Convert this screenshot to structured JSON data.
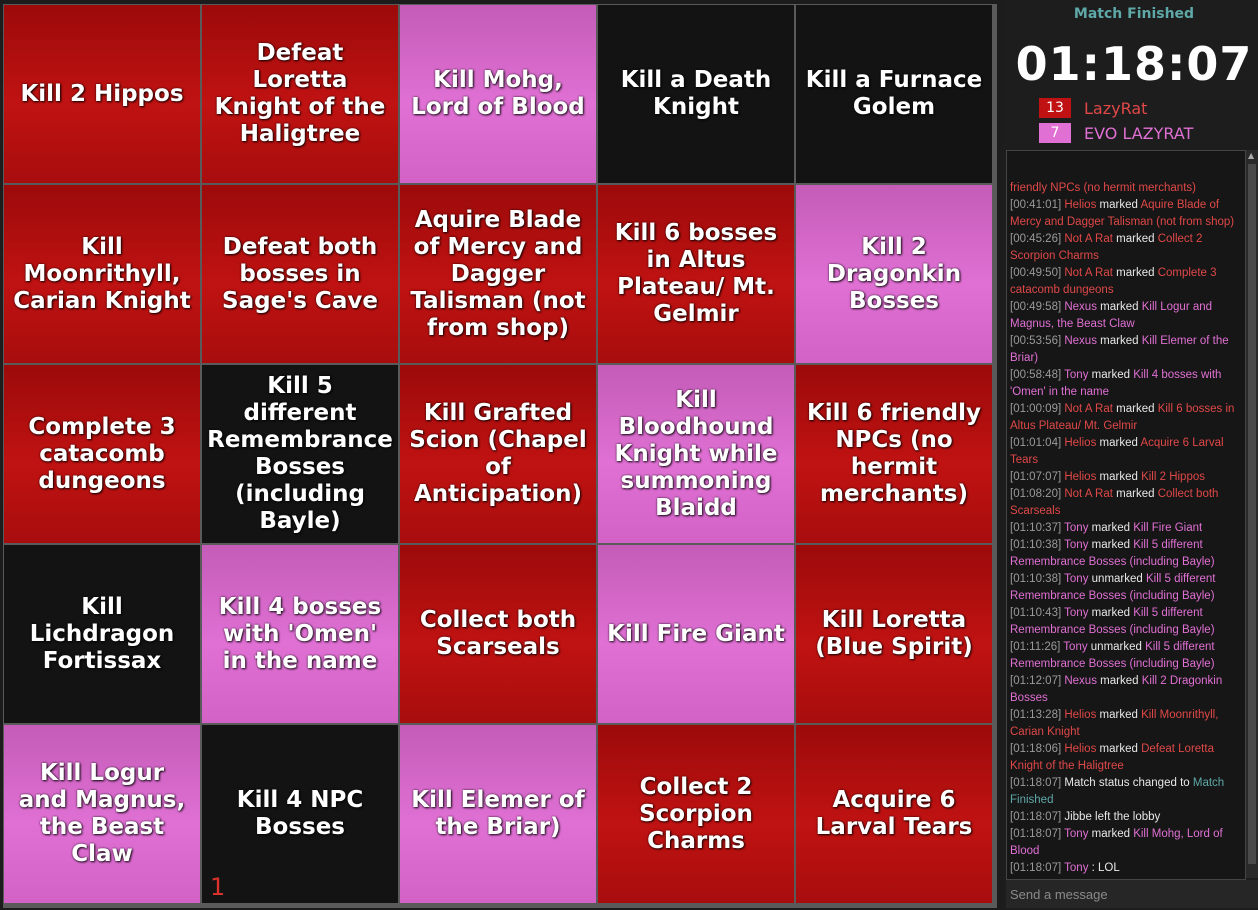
{
  "board": {
    "cells": [
      {
        "text": "Kill 2 Hippos",
        "color": "red"
      },
      {
        "text": "Defeat Loretta Knight of the Haligtree",
        "color": "red"
      },
      {
        "text": "Kill Mohg, Lord of Blood",
        "color": "pink"
      },
      {
        "text": "Kill a Death Knight",
        "color": "black"
      },
      {
        "text": "Kill a Furnace Golem",
        "color": "black"
      },
      {
        "text": "Kill Moonrithyll, Carian Knight",
        "color": "red"
      },
      {
        "text": "Defeat both bosses in Sage's Cave",
        "color": "red"
      },
      {
        "text": "Aquire Blade of Mercy and Dagger Talisman (not from shop)",
        "color": "red"
      },
      {
        "text": "Kill 6 bosses in Altus Plateau/ Mt. Gelmir",
        "color": "red"
      },
      {
        "text": "Kill 2 Dragonkin Bosses",
        "color": "pink"
      },
      {
        "text": "Complete 3 catacomb dungeons",
        "color": "red"
      },
      {
        "text": "Kill 5 different Remembrance Bosses (including Bayle)",
        "color": "black"
      },
      {
        "text": "Kill Grafted Scion (Chapel of Anticipation)",
        "color": "red"
      },
      {
        "text": "Kill Bloodhound Knight while summoning Blaidd",
        "color": "pink"
      },
      {
        "text": "Kill 6 friendly NPCs (no hermit merchants)",
        "color": "red"
      },
      {
        "text": "Kill Lichdragon Fortissax",
        "color": "black"
      },
      {
        "text": "Kill 4 bosses with 'Omen' in the name",
        "color": "pink"
      },
      {
        "text": "Collect both Scarseals",
        "color": "red"
      },
      {
        "text": "Kill Fire Giant",
        "color": "pink"
      },
      {
        "text": "Kill Loretta (Blue Spirit)",
        "color": "red"
      },
      {
        "text": "Kill Logur and Magnus, the Beast Claw",
        "color": "pink"
      },
      {
        "text": "Kill 4 NPC Bosses",
        "color": "black",
        "marker": "1"
      },
      {
        "text": "Kill Elemer of the Briar)",
        "color": "pink"
      },
      {
        "text": "Collect 2 Scorpion Charms",
        "color": "red"
      },
      {
        "text": "Acquire 6 Larval Tears",
        "color": "red"
      }
    ]
  },
  "sidebar": {
    "status": "Match Finished",
    "timer": "01:18:07",
    "teams": [
      {
        "score": "13",
        "name": "LazyRat",
        "color": "#c01212"
      },
      {
        "score": "7",
        "name": "EVO LAZYRAT",
        "color": "#e070d4"
      }
    ]
  },
  "chat": {
    "placeholder": "Send a message",
    "log": [
      [
        [
          "n-red",
          "friendly NPCs (no hermit merchants)"
        ]
      ],
      [
        [
          "ts",
          "[00:41:01] "
        ],
        [
          "n-red",
          "Helios"
        ],
        [
          "",
          " marked "
        ],
        [
          "n-red",
          "Aquire Blade of Mercy and Dagger Talisman (not from shop)"
        ]
      ],
      [
        [
          "ts",
          "[00:45:26] "
        ],
        [
          "n-red",
          "Not A Rat"
        ],
        [
          "",
          " marked "
        ],
        [
          "n-red",
          "Collect 2 Scorpion Charms"
        ]
      ],
      [
        [
          "ts",
          "[00:49:50] "
        ],
        [
          "n-red",
          "Not A Rat"
        ],
        [
          "",
          " marked "
        ],
        [
          "n-red",
          "Complete 3 catacomb dungeons"
        ]
      ],
      [
        [
          "ts",
          "[00:49:58] "
        ],
        [
          "n-pink",
          "Nexus"
        ],
        [
          "",
          " marked "
        ],
        [
          "n-pink",
          "Kill Logur and Magnus, the Beast Claw"
        ]
      ],
      [
        [
          "ts",
          "[00:53:56] "
        ],
        [
          "n-pink",
          "Nexus"
        ],
        [
          "",
          " marked "
        ],
        [
          "n-pink",
          "Kill Elemer of the Briar)"
        ]
      ],
      [
        [
          "ts",
          "[00:58:48] "
        ],
        [
          "n-pink",
          "Tony"
        ],
        [
          "",
          " marked "
        ],
        [
          "n-pink",
          "Kill 4 bosses with 'Omen' in the name"
        ]
      ],
      [
        [
          "ts",
          "[01:00:09] "
        ],
        [
          "n-red",
          "Not A Rat"
        ],
        [
          "",
          " marked "
        ],
        [
          "n-red",
          "Kill 6 bosses in Altus Plateau/ Mt. Gelmir"
        ]
      ],
      [
        [
          "ts",
          "[01:01:04] "
        ],
        [
          "n-red",
          "Helios"
        ],
        [
          "",
          " marked "
        ],
        [
          "n-red",
          "Acquire 6 Larval Tears"
        ]
      ],
      [
        [
          "ts",
          "[01:07:07] "
        ],
        [
          "n-red",
          "Helios"
        ],
        [
          "",
          " marked "
        ],
        [
          "n-red",
          "Kill 2 Hippos"
        ]
      ],
      [
        [
          "ts",
          "[01:08:20] "
        ],
        [
          "n-red",
          "Not A Rat"
        ],
        [
          "",
          " marked "
        ],
        [
          "n-red",
          "Collect both Scarseals"
        ]
      ],
      [
        [
          "ts",
          "[01:10:37] "
        ],
        [
          "n-pink",
          "Tony"
        ],
        [
          "",
          " marked "
        ],
        [
          "n-pink",
          "Kill Fire Giant"
        ]
      ],
      [
        [
          "ts",
          "[01:10:38] "
        ],
        [
          "n-pink",
          "Tony"
        ],
        [
          "",
          " marked "
        ],
        [
          "n-pink",
          "Kill 5 different Remembrance Bosses (including Bayle)"
        ]
      ],
      [
        [
          "ts",
          "[01:10:38] "
        ],
        [
          "n-pink",
          "Tony"
        ],
        [
          "",
          " unmarked "
        ],
        [
          "n-pink",
          "Kill 5 different Remembrance Bosses (including Bayle)"
        ]
      ],
      [
        [
          "ts",
          "[01:10:43] "
        ],
        [
          "n-pink",
          "Tony"
        ],
        [
          "",
          " marked "
        ],
        [
          "n-pink",
          "Kill 5 different Remembrance Bosses (including Bayle)"
        ]
      ],
      [
        [
          "ts",
          "[01:11:26] "
        ],
        [
          "n-pink",
          "Tony"
        ],
        [
          "",
          " unmarked "
        ],
        [
          "n-pink",
          "Kill 5 different Remembrance Bosses (including Bayle)"
        ]
      ],
      [
        [
          "ts",
          "[01:12:07] "
        ],
        [
          "n-pink",
          "Nexus"
        ],
        [
          "",
          " marked "
        ],
        [
          "n-pink",
          "Kill 2 Dragonkin Bosses"
        ]
      ],
      [
        [
          "ts",
          "[01:13:28] "
        ],
        [
          "n-red",
          "Helios"
        ],
        [
          "",
          " marked "
        ],
        [
          "n-red",
          "Kill Moonrithyll, Carian Knight"
        ]
      ],
      [
        [
          "ts",
          "[01:18:06] "
        ],
        [
          "n-red",
          "Helios"
        ],
        [
          "",
          " marked "
        ],
        [
          "n-red",
          "Defeat Loretta Knight of the Haligtree"
        ]
      ],
      [
        [
          "ts",
          "[01:18:07] "
        ],
        [
          "",
          "Match status changed to "
        ],
        [
          "n-teal",
          "Match Finished"
        ]
      ],
      [
        [
          "ts",
          "[01:18:07] "
        ],
        [
          "",
          "Jibbe left the lobby"
        ]
      ],
      [
        [
          "ts",
          "[01:18:07] "
        ],
        [
          "n-pink",
          "Tony"
        ],
        [
          "",
          " marked "
        ],
        [
          "n-pink",
          "Kill Mohg, Lord of Blood"
        ]
      ],
      [
        [
          "ts",
          "[01:18:07] "
        ],
        [
          "n-pink",
          "Tony"
        ],
        [
          "",
          " : LOL"
        ]
      ]
    ]
  }
}
